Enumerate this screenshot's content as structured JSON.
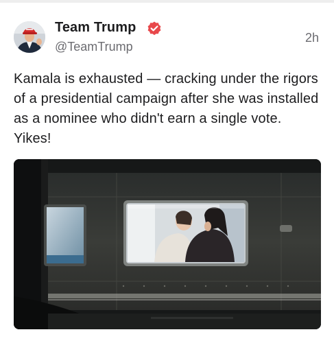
{
  "post": {
    "author": {
      "display_name": "Team Trump",
      "handle": "@TeamTrump",
      "verified": true,
      "verified_badge_color": "#e8484b",
      "avatar_icon": "profile-photo-icon"
    },
    "timestamp": "2h",
    "text": "Kamala is exhausted — cracking under the rigors of a presidential campaign after she was installed as a nominee who didn't earn a single vote. Yikes!",
    "media": {
      "type": "photo",
      "icon": "photo-icon"
    }
  },
  "colors": {
    "text_primary": "#1c1c1e",
    "text_secondary": "#6b6b70",
    "background": "#ffffff"
  }
}
